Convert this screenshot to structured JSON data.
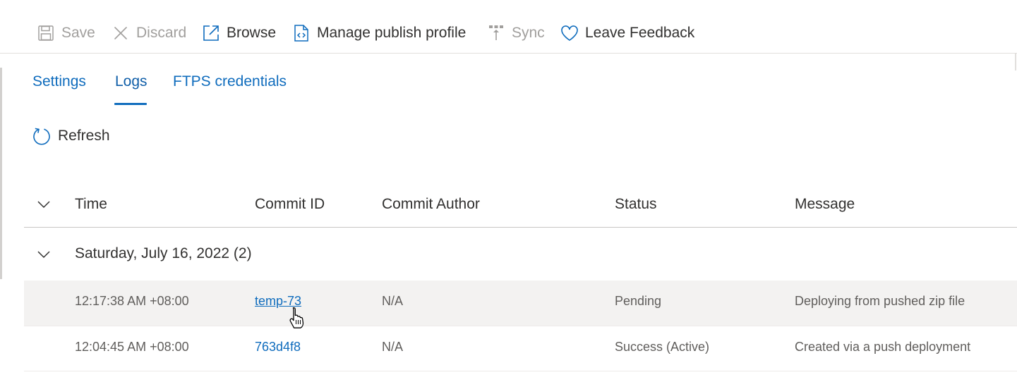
{
  "toolbar": {
    "save": "Save",
    "discard": "Discard",
    "browse": "Browse",
    "manage_publish_profile": "Manage publish profile",
    "sync": "Sync",
    "leave_feedback": "Leave Feedback"
  },
  "tabs": [
    {
      "label": "Settings",
      "active": false
    },
    {
      "label": "Logs",
      "active": true
    },
    {
      "label": "FTPS credentials",
      "active": false
    }
  ],
  "refresh_label": "Refresh",
  "table": {
    "columns": [
      "Time",
      "Commit ID",
      "Commit Author",
      "Status",
      "Message"
    ],
    "group": {
      "title": "Saturday, July 16, 2022 (2)"
    },
    "rows": [
      {
        "time": "12:17:38 AM +08:00",
        "commit_id": "temp-73",
        "author": "N/A",
        "status": "Pending",
        "message": "Deploying from pushed zip file"
      },
      {
        "time": "12:04:45 AM +08:00",
        "commit_id": "763d4f8",
        "author": "N/A",
        "status": "Success (Active)",
        "message": "Created via a push deployment"
      }
    ]
  },
  "colors": {
    "link": "#0f6cbd",
    "disabled_text": "#a19f9d",
    "hover_row": "#f3f2f1"
  }
}
